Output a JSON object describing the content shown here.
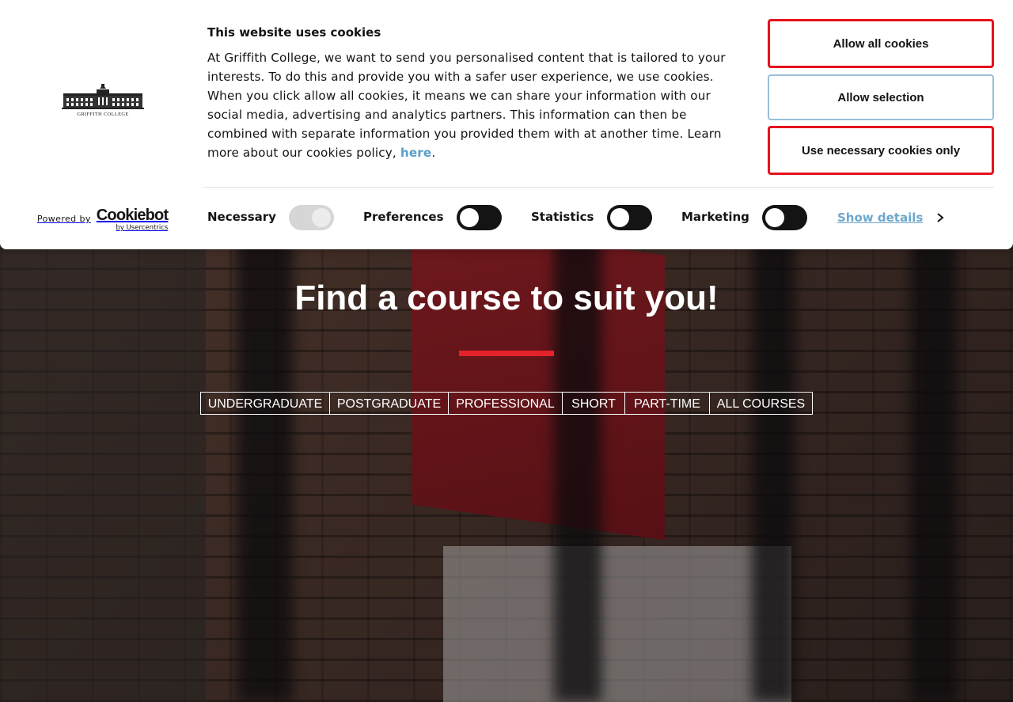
{
  "banner": {
    "title": "This website uses cookies",
    "text": "At Griffith College, we want to send you personalised content that is tailored to your interests. To do this and provide you with a safer user experience, we use cookies. When you click allow all cookies, it means we can share your information with our social media, advertising and analytics partners. This information can then be combined with separate information you provided them with at another time. Learn more about our cookies policy, ",
    "link_label": "here",
    "text_end": ".",
    "logo_text": "GRIFFITH COLLEGE",
    "buttons": {
      "allow_all": "Allow all cookies",
      "allow_selection": "Allow selection",
      "necessary_only": "Use necessary cookies only"
    },
    "powered_by": "Powered by",
    "cookiebot": "Cookiebot",
    "cookiebot_sub": "by Usercentrics",
    "toggles": [
      {
        "label": "Necessary",
        "on": false,
        "disabled": true
      },
      {
        "label": "Preferences",
        "on": false,
        "disabled": false
      },
      {
        "label": "Statistics",
        "on": false,
        "disabled": false
      },
      {
        "label": "Marketing",
        "on": false,
        "disabled": false
      }
    ],
    "show_details": "Show details",
    "colors": {
      "accent_red": "#e4121c",
      "link_blue": "#5a9ec8"
    }
  },
  "hero": {
    "title": "Find a course to suit you!",
    "tabs": [
      "UNDERGRADUATE",
      "POSTGRADUATE",
      "PROFESSIONAL",
      "SHORT",
      "PART-TIME",
      "ALL COURSES"
    ]
  }
}
